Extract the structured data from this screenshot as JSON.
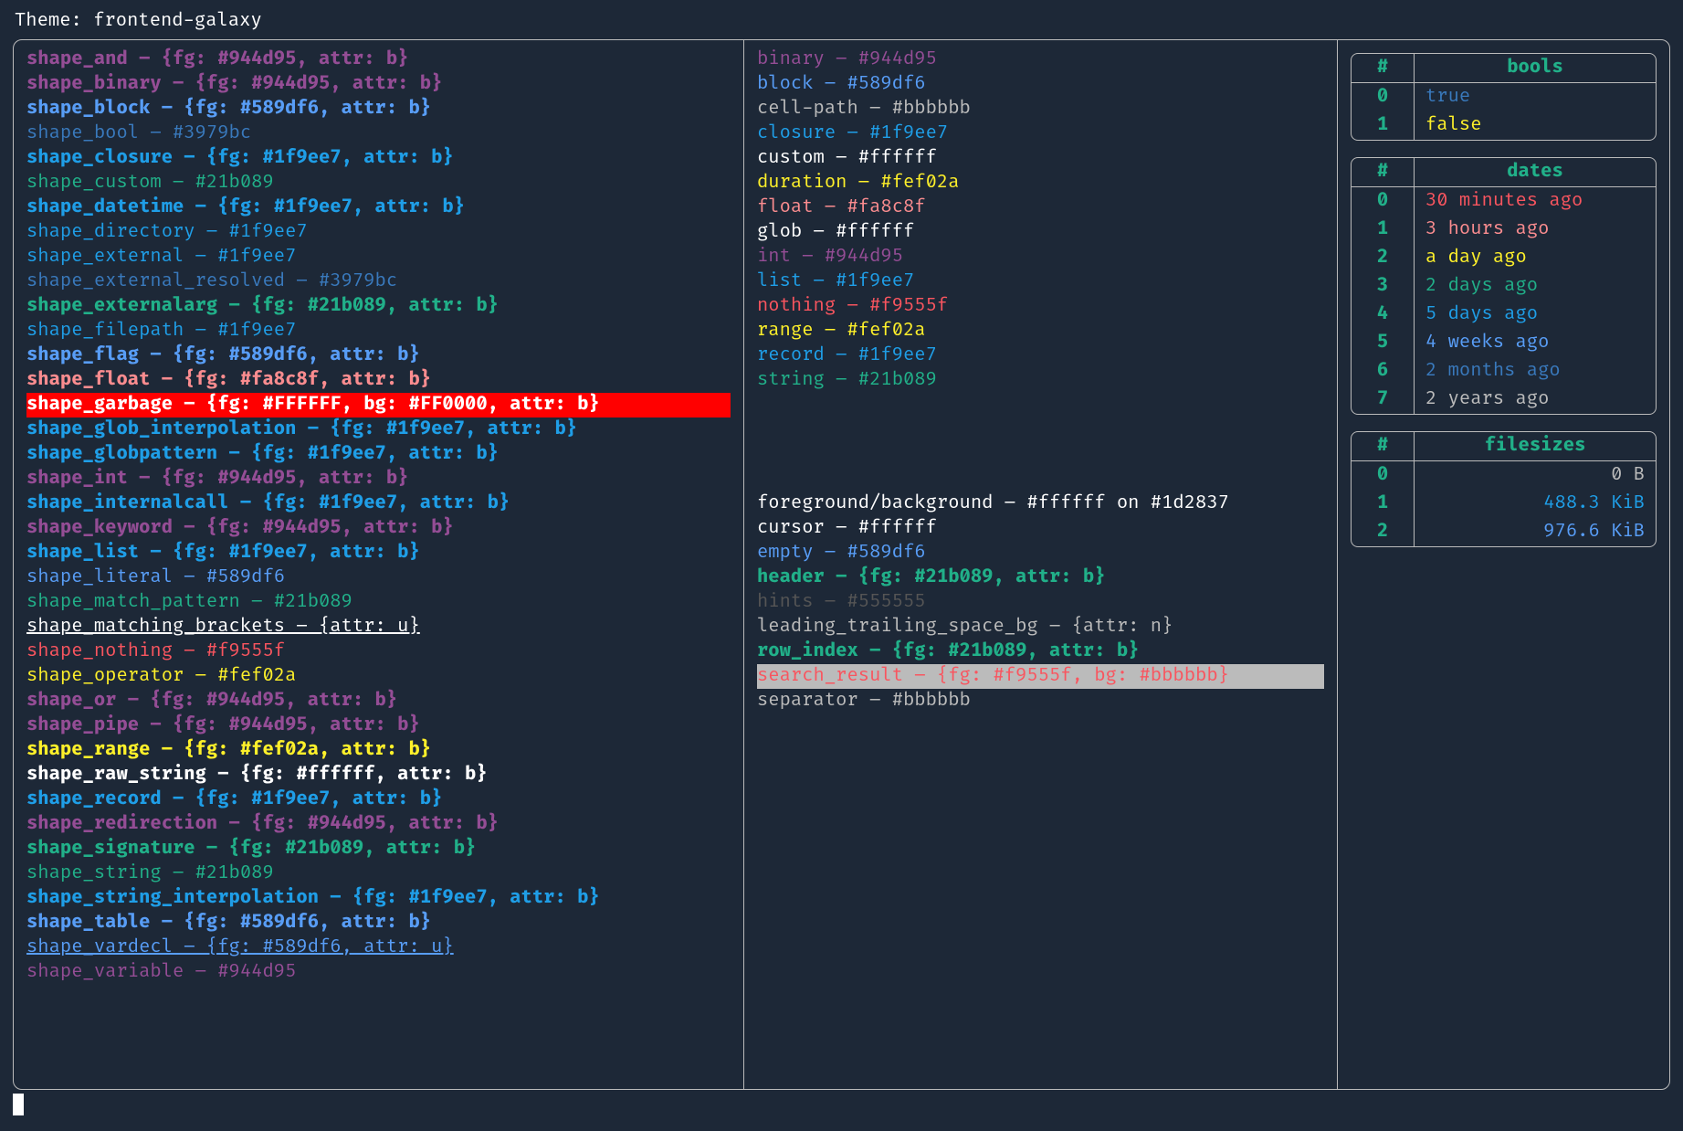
{
  "title_prefix": "Theme: ",
  "theme_name": "frontend-galaxy",
  "shapes": [
    {
      "name": "shape_and",
      "def": "{fg: #944d95, attr: b}",
      "cls": "c-purple b"
    },
    {
      "name": "shape_binary",
      "def": "{fg: #944d95, attr: b}",
      "cls": "c-purple b"
    },
    {
      "name": "shape_block",
      "def": "{fg: #589df6, attr: b}",
      "cls": "c-blue b"
    },
    {
      "name": "shape_bool",
      "def": "#3979bc",
      "cls": "c-steel"
    },
    {
      "name": "shape_closure",
      "def": "{fg: #1f9ee7, attr: b}",
      "cls": "c-cyan b"
    },
    {
      "name": "shape_custom",
      "def": "#21b089",
      "cls": "c-teal"
    },
    {
      "name": "shape_datetime",
      "def": "{fg: #1f9ee7, attr: b}",
      "cls": "c-cyan b"
    },
    {
      "name": "shape_directory",
      "def": "#1f9ee7",
      "cls": "c-cyan"
    },
    {
      "name": "shape_external",
      "def": "#1f9ee7",
      "cls": "c-cyan"
    },
    {
      "name": "shape_external_resolved",
      "def": "#3979bc",
      "cls": "c-steel"
    },
    {
      "name": "shape_externalarg",
      "def": "{fg: #21b089, attr: b}",
      "cls": "c-teal b"
    },
    {
      "name": "shape_filepath",
      "def": "#1f9ee7",
      "cls": "c-cyan"
    },
    {
      "name": "shape_flag",
      "def": "{fg: #589df6, attr: b}",
      "cls": "c-blue b"
    },
    {
      "name": "shape_float",
      "def": "{fg: #fa8c8f, attr: b}",
      "cls": "c-salmon b"
    },
    {
      "name": "shape_garbage",
      "def": "{fg: #FFFFFF, bg: #FF0000, attr: b}",
      "cls": "c-white b bg-red"
    },
    {
      "name": "shape_glob_interpolation",
      "def": "{fg: #1f9ee7, attr: b}",
      "cls": "c-cyan b"
    },
    {
      "name": "shape_globpattern",
      "def": "{fg: #1f9ee7, attr: b}",
      "cls": "c-cyan b"
    },
    {
      "name": "shape_int",
      "def": "{fg: #944d95, attr: b}",
      "cls": "c-purple b"
    },
    {
      "name": "shape_internalcall",
      "def": "{fg: #1f9ee7, attr: b}",
      "cls": "c-cyan b"
    },
    {
      "name": "shape_keyword",
      "def": "{fg: #944d95, attr: b}",
      "cls": "c-purple b"
    },
    {
      "name": "shape_list",
      "def": "{fg: #1f9ee7, attr: b}",
      "cls": "c-cyan b"
    },
    {
      "name": "shape_literal",
      "def": "#589df6",
      "cls": "c-blue"
    },
    {
      "name": "shape_match_pattern",
      "def": "#21b089",
      "cls": "c-teal"
    },
    {
      "name": "shape_matching_brackets",
      "def": "{attr: u}",
      "cls": "u"
    },
    {
      "name": "shape_nothing",
      "def": "#f9555f",
      "cls": "c-red"
    },
    {
      "name": "shape_operator",
      "def": "#fef02a",
      "cls": "c-yellow"
    },
    {
      "name": "shape_or",
      "def": "{fg: #944d95, attr: b}",
      "cls": "c-purple b"
    },
    {
      "name": "shape_pipe",
      "def": "{fg: #944d95, attr: b}",
      "cls": "c-purple b"
    },
    {
      "name": "shape_range",
      "def": "{fg: #fef02a, attr: b}",
      "cls": "c-yellow b"
    },
    {
      "name": "shape_raw_string",
      "def": "{fg: #ffffff, attr: b}",
      "cls": "c-white b"
    },
    {
      "name": "shape_record",
      "def": "{fg: #1f9ee7, attr: b}",
      "cls": "c-cyan b"
    },
    {
      "name": "shape_redirection",
      "def": "{fg: #944d95, attr: b}",
      "cls": "c-purple b"
    },
    {
      "name": "shape_signature",
      "def": "{fg: #21b089, attr: b}",
      "cls": "c-teal b"
    },
    {
      "name": "shape_string",
      "def": "#21b089",
      "cls": "c-teal"
    },
    {
      "name": "shape_string_interpolation",
      "def": "{fg: #1f9ee7, attr: b}",
      "cls": "c-cyan b"
    },
    {
      "name": "shape_table",
      "def": "{fg: #589df6, attr: b}",
      "cls": "c-blue b"
    },
    {
      "name": "shape_vardecl",
      "def": "{fg: #589df6, attr: u}",
      "cls": "c-blue u"
    },
    {
      "name": "shape_variable",
      "def": "#944d95",
      "cls": "c-purple"
    }
  ],
  "types": [
    {
      "name": "binary",
      "def": "#944d95",
      "cls": "c-purple"
    },
    {
      "name": "block",
      "def": "#589df6",
      "cls": "c-blue"
    },
    {
      "name": "cell-path",
      "def": "#bbbbbb",
      "cls": "c-grey"
    },
    {
      "name": "closure",
      "def": "#1f9ee7",
      "cls": "c-cyan"
    },
    {
      "name": "custom",
      "def": "#ffffff",
      "cls": "c-white"
    },
    {
      "name": "duration",
      "def": "#fef02a",
      "cls": "c-yellow"
    },
    {
      "name": "float",
      "def": "#fa8c8f",
      "cls": "c-salmon"
    },
    {
      "name": "glob",
      "def": "#ffffff",
      "cls": "c-white"
    },
    {
      "name": "int",
      "def": "#944d95",
      "cls": "c-purple"
    },
    {
      "name": "list",
      "def": "#1f9ee7",
      "cls": "c-cyan"
    },
    {
      "name": "nothing",
      "def": "#f9555f",
      "cls": "c-red"
    },
    {
      "name": "range",
      "def": "#fef02a",
      "cls": "c-yellow"
    },
    {
      "name": "record",
      "def": "#1f9ee7",
      "cls": "c-cyan"
    },
    {
      "name": "string",
      "def": "#21b089",
      "cls": "c-teal"
    }
  ],
  "misc": [
    {
      "name": "foreground/background",
      "def": "#ffffff on #1d2837",
      "cls": "c-white"
    },
    {
      "name": "cursor",
      "def": "#ffffff",
      "cls": "c-white"
    },
    {
      "name": "empty",
      "def": "#589df6",
      "cls": "c-blue"
    },
    {
      "name": "header",
      "def": "{fg: #21b089, attr: b}",
      "cls": "c-teal b"
    },
    {
      "name": "hints",
      "def": "#555555",
      "cls": "c-dim"
    },
    {
      "name": "leading_trailing_space_bg",
      "def": "{attr: n}",
      "cls": "c-grey"
    },
    {
      "name": "row_index",
      "def": "{fg: #21b089, attr: b}",
      "cls": "c-teal b"
    },
    {
      "name": "search_result",
      "def": "{fg: #f9555f, bg: #bbbbbb}",
      "cls": "c-red bg-grey"
    },
    {
      "name": "separator",
      "def": "#bbbbbb",
      "cls": "c-grey"
    }
  ],
  "tables": {
    "bools": {
      "header": "bools",
      "rows": [
        {
          "idx": "0",
          "val": "true",
          "cls": "c-steel"
        },
        {
          "idx": "1",
          "val": "false",
          "cls": "c-yellow b"
        }
      ]
    },
    "dates": {
      "header": "dates",
      "rows": [
        {
          "idx": "0",
          "val": "30 minutes ago",
          "cls": "c-red b"
        },
        {
          "idx": "1",
          "val": "3 hours ago",
          "cls": "c-salmon"
        },
        {
          "idx": "2",
          "val": "a day ago",
          "cls": "c-yellow"
        },
        {
          "idx": "3",
          "val": "2 days ago",
          "cls": "c-teal"
        },
        {
          "idx": "4",
          "val": "5 days ago",
          "cls": "c-cyan"
        },
        {
          "idx": "5",
          "val": "4 weeks ago",
          "cls": "c-blue"
        },
        {
          "idx": "6",
          "val": "2 months ago",
          "cls": "c-steel"
        },
        {
          "idx": "7",
          "val": "2 years ago",
          "cls": "c-grey"
        }
      ]
    },
    "filesizes": {
      "header": "filesizes",
      "rows": [
        {
          "idx": "0",
          "val": "0 B",
          "cls": "c-grey"
        },
        {
          "idx": "1",
          "val": "488.3 KiB",
          "cls": "c-cyan"
        },
        {
          "idx": "2",
          "val": "976.6 KiB",
          "cls": "c-blue"
        }
      ]
    }
  },
  "hash": "#"
}
